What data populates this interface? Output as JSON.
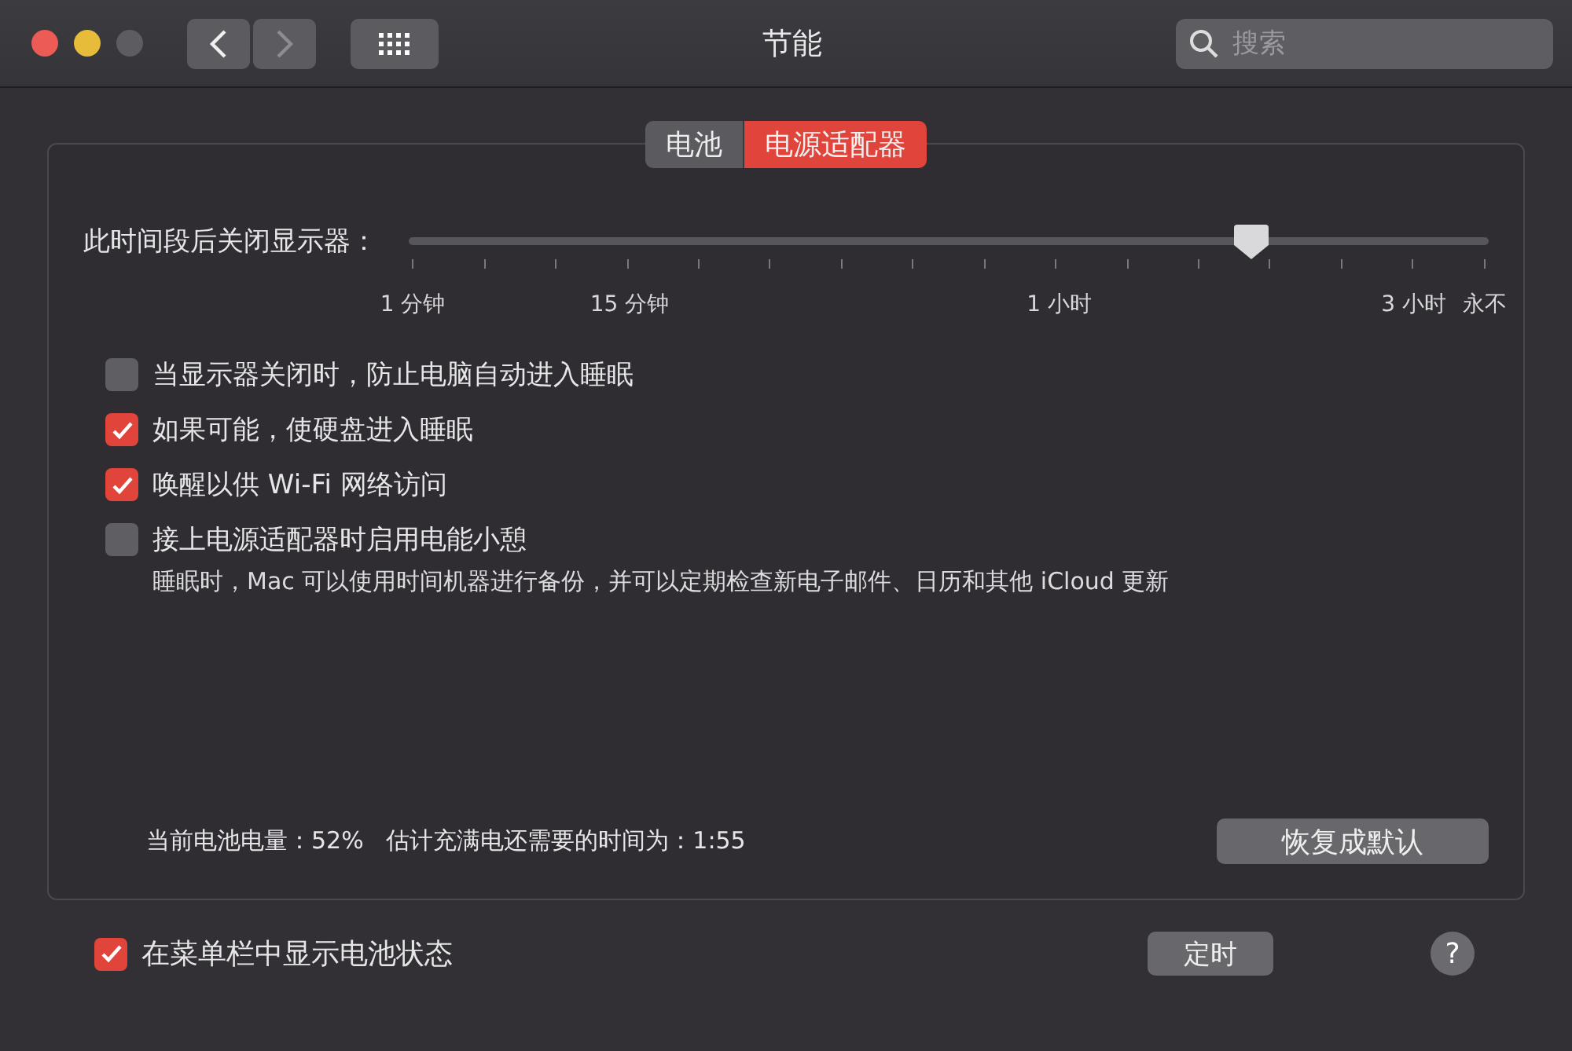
{
  "window": {
    "title": "节能"
  },
  "search": {
    "placeholder": "搜索"
  },
  "tabs": [
    {
      "label": "电池",
      "selected": false
    },
    {
      "label": "电源适配器",
      "selected": true
    }
  ],
  "display_sleep": {
    "label": "此时间段后关闭显示器：",
    "level": 0.78,
    "scale": [
      "1 分钟",
      "15 分钟",
      "1 小时",
      "3 小时",
      "永不"
    ]
  },
  "options": [
    {
      "label": "当显示器关闭时，防止电脑自动进入睡眠",
      "checked": false
    },
    {
      "label": "如果可能，使硬盘进入睡眠",
      "checked": true
    },
    {
      "label": "唤醒以供 Wi-Fi 网络访问",
      "checked": true
    },
    {
      "label": "接上电源适配器时启用电能小憩",
      "checked": false,
      "note": "睡眠时，Mac 可以使用时间机器进行备份，并可以定期检查新电子邮件、日历和其他 iCloud 更新"
    }
  ],
  "battery_status": "当前电池电量：52%   估计充满电还需要的时间为：1:55",
  "restore_button": "恢复成默认",
  "menu_bar_option": {
    "label": "在菜单栏中显示电池状态",
    "checked": true
  },
  "schedule_button": "定时",
  "help_button": "?"
}
